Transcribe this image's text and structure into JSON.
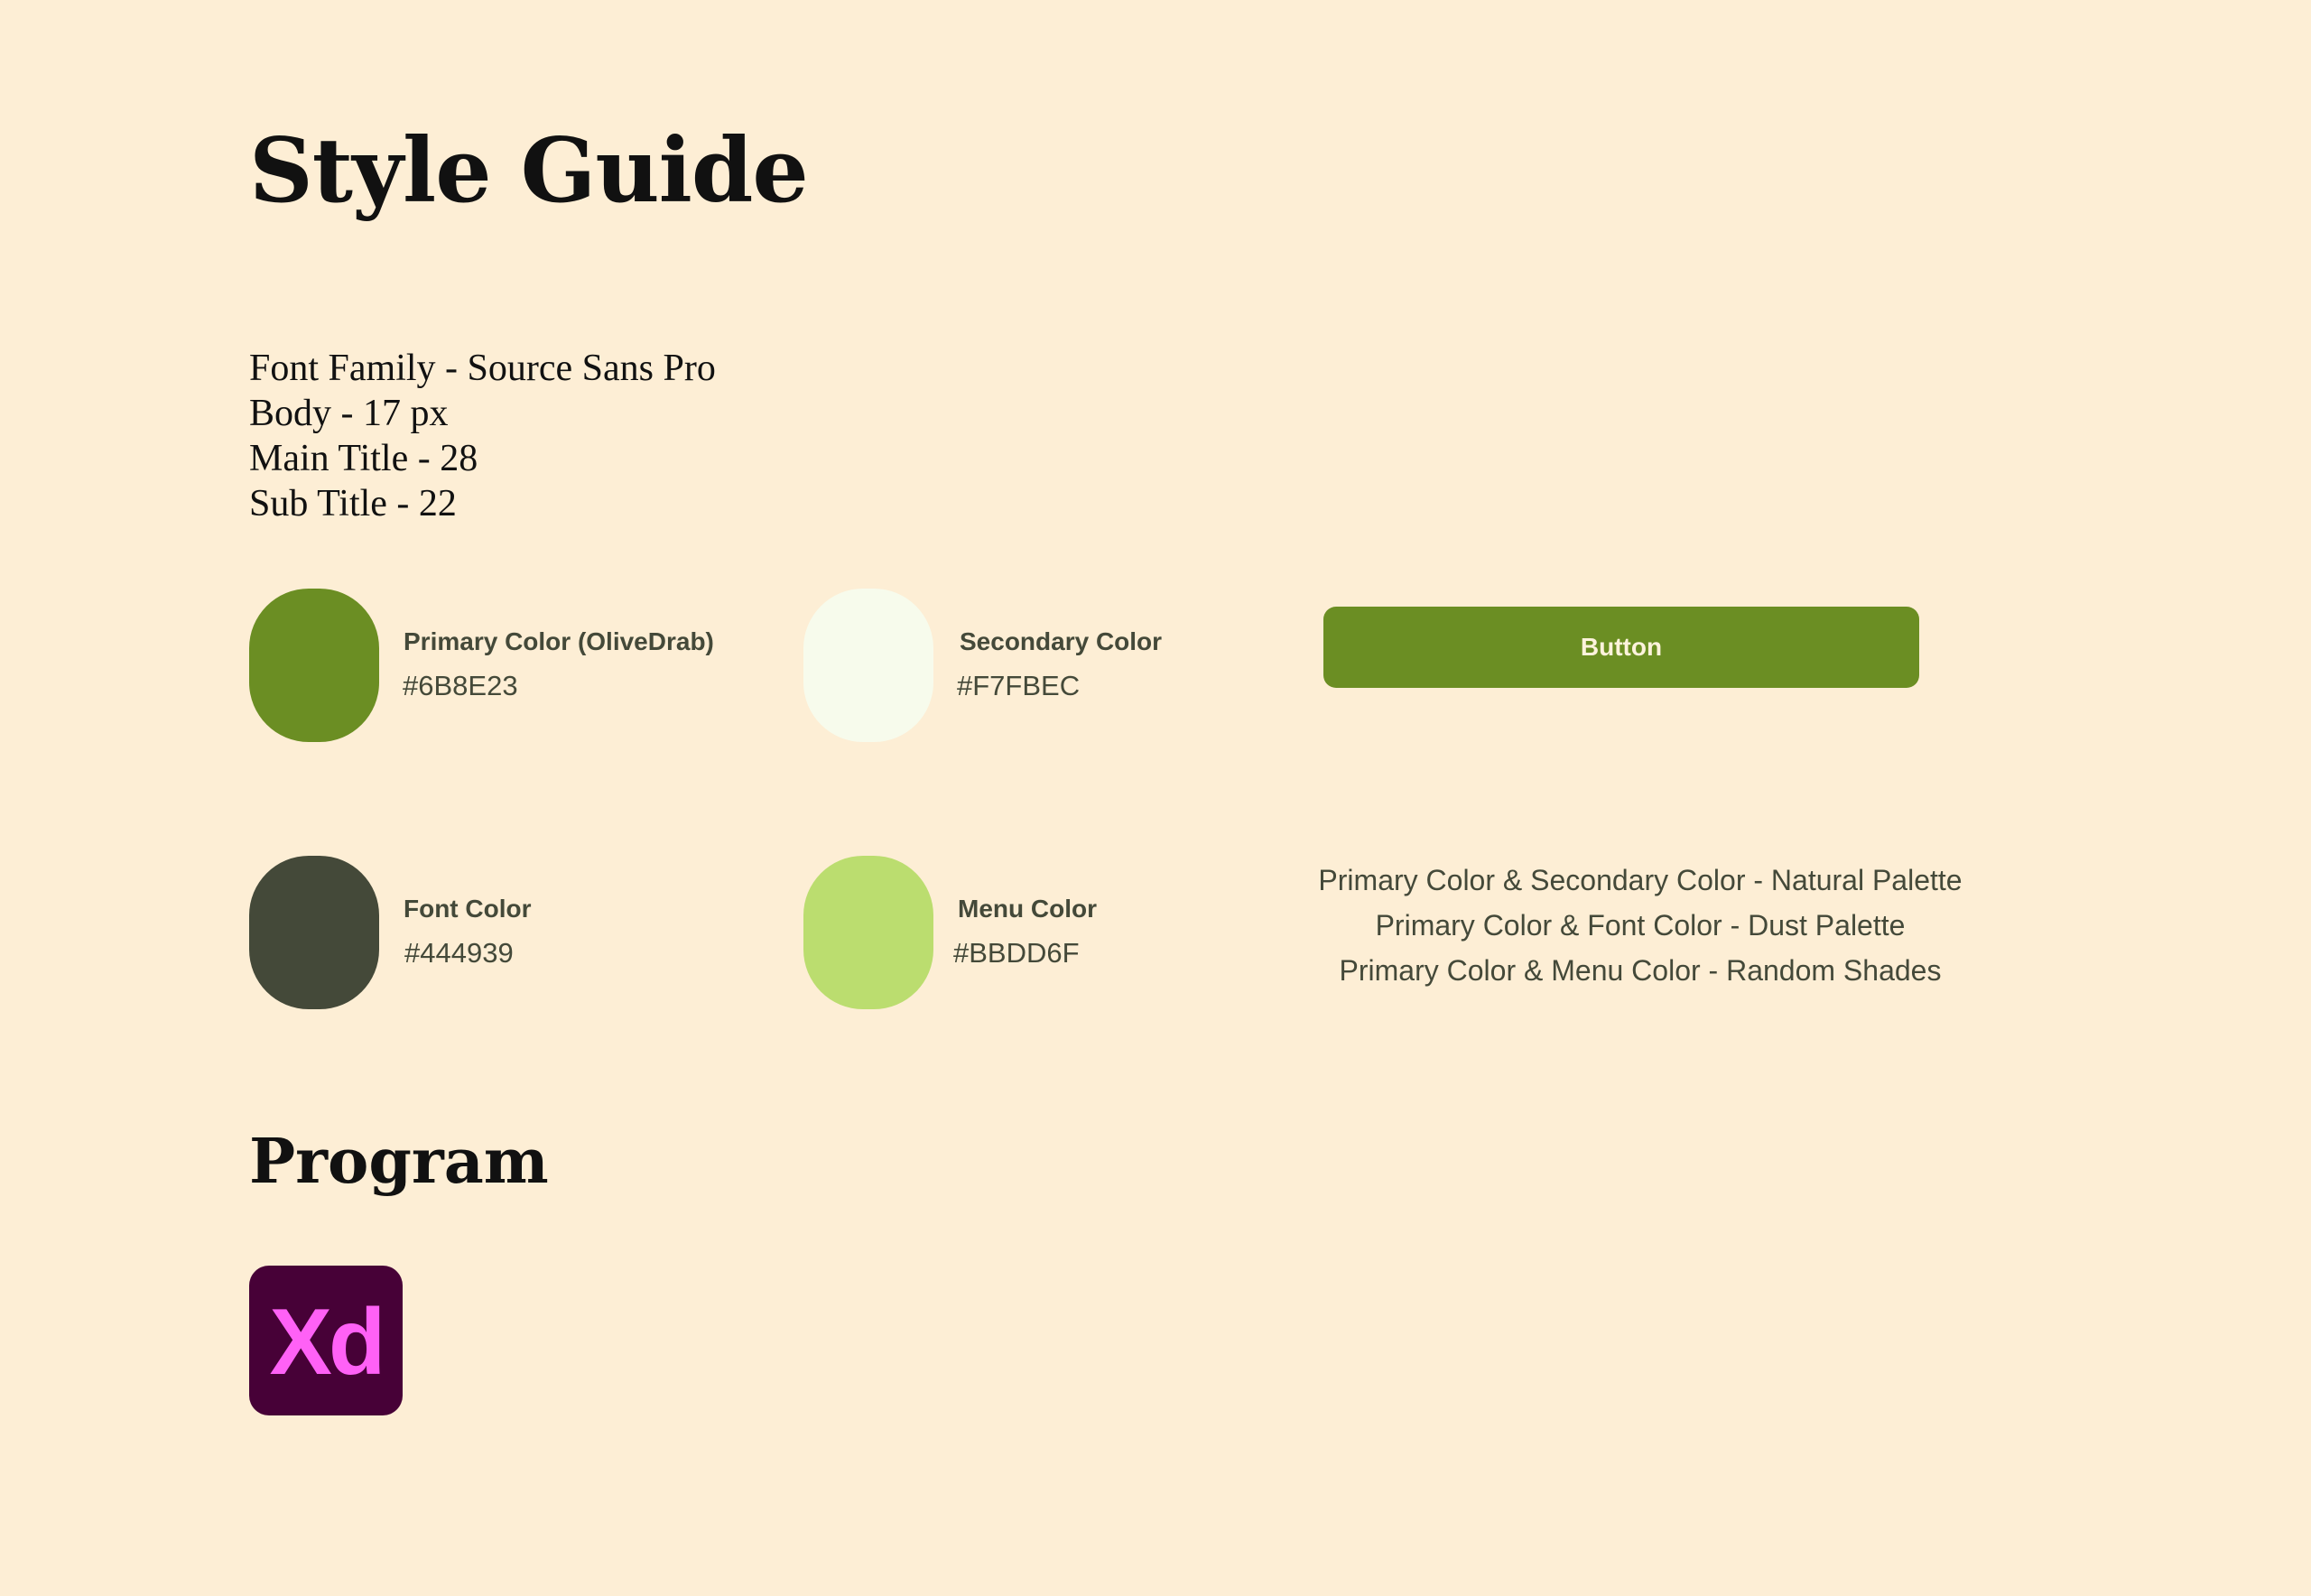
{
  "title": "Style Guide",
  "typography": {
    "lines": [
      "Font Family - Source Sans Pro",
      "Body - 17 px",
      "Main Title - 28",
      "Sub Title - 22"
    ]
  },
  "colors": [
    {
      "name": "Primary Color (OliveDrab)",
      "hex": "#6B8E23",
      "value": "#6b8e23"
    },
    {
      "name": "Secondary Color",
      "hex": "#F7FBEC",
      "value": "#f7fbec"
    },
    {
      "name": "Font Color",
      "hex": "#444939",
      "value": "#444939"
    },
    {
      "name": "Menu Color",
      "hex": "#BBDD6F",
      "value": "#bbdd6f"
    }
  ],
  "button": {
    "label": "Button",
    "color": "#6b8e23",
    "text_color": "#fdf3dc"
  },
  "palette_notes": [
    "Primary Color & Secondary Color - Natural Palette",
    "Primary Color & Font Color - Dust Palette",
    "Primary Color & Menu Color - Random Shades"
  ],
  "program": {
    "title": "Program",
    "logo_text": "Xd",
    "logo_icon": "adobe-xd-icon",
    "logo_bg": "#470137",
    "logo_fg": "#ff61f6"
  },
  "background": "#fdeed5"
}
